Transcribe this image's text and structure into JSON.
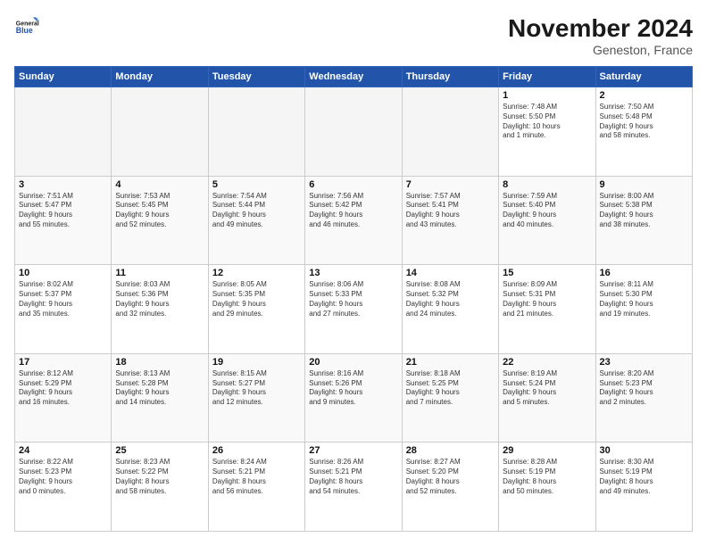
{
  "app": {
    "name": "GeneralBlue",
    "tagline": "General\nBlue"
  },
  "header": {
    "month_title": "November 2024",
    "location": "Geneston, France"
  },
  "weekdays": [
    "Sunday",
    "Monday",
    "Tuesday",
    "Wednesday",
    "Thursday",
    "Friday",
    "Saturday"
  ],
  "weeks": [
    [
      {
        "day": "",
        "content": ""
      },
      {
        "day": "",
        "content": ""
      },
      {
        "day": "",
        "content": ""
      },
      {
        "day": "",
        "content": ""
      },
      {
        "day": "",
        "content": ""
      },
      {
        "day": "1",
        "content": "Sunrise: 7:48 AM\nSunset: 5:50 PM\nDaylight: 10 hours\nand 1 minute."
      },
      {
        "day": "2",
        "content": "Sunrise: 7:50 AM\nSunset: 5:48 PM\nDaylight: 9 hours\nand 58 minutes."
      }
    ],
    [
      {
        "day": "3",
        "content": "Sunrise: 7:51 AM\nSunset: 5:47 PM\nDaylight: 9 hours\nand 55 minutes."
      },
      {
        "day": "4",
        "content": "Sunrise: 7:53 AM\nSunset: 5:45 PM\nDaylight: 9 hours\nand 52 minutes."
      },
      {
        "day": "5",
        "content": "Sunrise: 7:54 AM\nSunset: 5:44 PM\nDaylight: 9 hours\nand 49 minutes."
      },
      {
        "day": "6",
        "content": "Sunrise: 7:56 AM\nSunset: 5:42 PM\nDaylight: 9 hours\nand 46 minutes."
      },
      {
        "day": "7",
        "content": "Sunrise: 7:57 AM\nSunset: 5:41 PM\nDaylight: 9 hours\nand 43 minutes."
      },
      {
        "day": "8",
        "content": "Sunrise: 7:59 AM\nSunset: 5:40 PM\nDaylight: 9 hours\nand 40 minutes."
      },
      {
        "day": "9",
        "content": "Sunrise: 8:00 AM\nSunset: 5:38 PM\nDaylight: 9 hours\nand 38 minutes."
      }
    ],
    [
      {
        "day": "10",
        "content": "Sunrise: 8:02 AM\nSunset: 5:37 PM\nDaylight: 9 hours\nand 35 minutes."
      },
      {
        "day": "11",
        "content": "Sunrise: 8:03 AM\nSunset: 5:36 PM\nDaylight: 9 hours\nand 32 minutes."
      },
      {
        "day": "12",
        "content": "Sunrise: 8:05 AM\nSunset: 5:35 PM\nDaylight: 9 hours\nand 29 minutes."
      },
      {
        "day": "13",
        "content": "Sunrise: 8:06 AM\nSunset: 5:33 PM\nDaylight: 9 hours\nand 27 minutes."
      },
      {
        "day": "14",
        "content": "Sunrise: 8:08 AM\nSunset: 5:32 PM\nDaylight: 9 hours\nand 24 minutes."
      },
      {
        "day": "15",
        "content": "Sunrise: 8:09 AM\nSunset: 5:31 PM\nDaylight: 9 hours\nand 21 minutes."
      },
      {
        "day": "16",
        "content": "Sunrise: 8:11 AM\nSunset: 5:30 PM\nDaylight: 9 hours\nand 19 minutes."
      }
    ],
    [
      {
        "day": "17",
        "content": "Sunrise: 8:12 AM\nSunset: 5:29 PM\nDaylight: 9 hours\nand 16 minutes."
      },
      {
        "day": "18",
        "content": "Sunrise: 8:13 AM\nSunset: 5:28 PM\nDaylight: 9 hours\nand 14 minutes."
      },
      {
        "day": "19",
        "content": "Sunrise: 8:15 AM\nSunset: 5:27 PM\nDaylight: 9 hours\nand 12 minutes."
      },
      {
        "day": "20",
        "content": "Sunrise: 8:16 AM\nSunset: 5:26 PM\nDaylight: 9 hours\nand 9 minutes."
      },
      {
        "day": "21",
        "content": "Sunrise: 8:18 AM\nSunset: 5:25 PM\nDaylight: 9 hours\nand 7 minutes."
      },
      {
        "day": "22",
        "content": "Sunrise: 8:19 AM\nSunset: 5:24 PM\nDaylight: 9 hours\nand 5 minutes."
      },
      {
        "day": "23",
        "content": "Sunrise: 8:20 AM\nSunset: 5:23 PM\nDaylight: 9 hours\nand 2 minutes."
      }
    ],
    [
      {
        "day": "24",
        "content": "Sunrise: 8:22 AM\nSunset: 5:23 PM\nDaylight: 9 hours\nand 0 minutes."
      },
      {
        "day": "25",
        "content": "Sunrise: 8:23 AM\nSunset: 5:22 PM\nDaylight: 8 hours\nand 58 minutes."
      },
      {
        "day": "26",
        "content": "Sunrise: 8:24 AM\nSunset: 5:21 PM\nDaylight: 8 hours\nand 56 minutes."
      },
      {
        "day": "27",
        "content": "Sunrise: 8:26 AM\nSunset: 5:21 PM\nDaylight: 8 hours\nand 54 minutes."
      },
      {
        "day": "28",
        "content": "Sunrise: 8:27 AM\nSunset: 5:20 PM\nDaylight: 8 hours\nand 52 minutes."
      },
      {
        "day": "29",
        "content": "Sunrise: 8:28 AM\nSunset: 5:19 PM\nDaylight: 8 hours\nand 50 minutes."
      },
      {
        "day": "30",
        "content": "Sunrise: 8:30 AM\nSunset: 5:19 PM\nDaylight: 8 hours\nand 49 minutes."
      }
    ]
  ]
}
